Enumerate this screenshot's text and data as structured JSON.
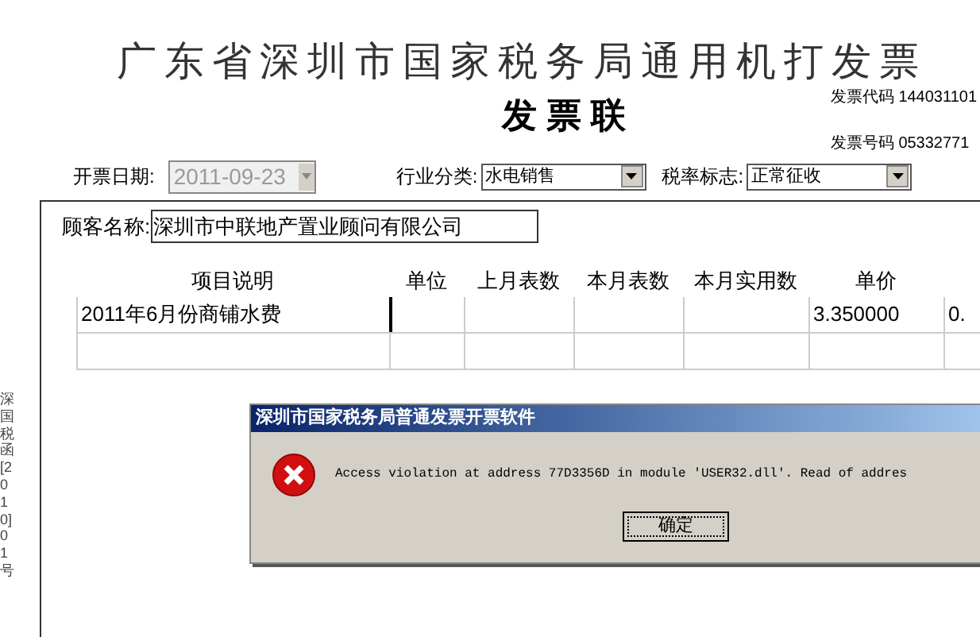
{
  "invoice": {
    "title": "广东省深圳市国家税务局通用机打发票",
    "copy_label": "发 票 联",
    "code_label": "发票代码",
    "code": "144031101",
    "number_label": "发票号码",
    "number": "05332771"
  },
  "fields": {
    "date_label": "开票日期:",
    "date": "2011-09-23",
    "date_disabled": true,
    "industry_label": "行业分类:",
    "industry": "水电销售",
    "tax_label": "税率标志:",
    "tax": "正常征收",
    "customer_label": "顾客名称:",
    "customer": "深圳市中联地产置业顾问有限公司"
  },
  "side_text": "深国税函[2010]01号",
  "table": {
    "columns": [
      "项目说明",
      "单位",
      "上月表数",
      "本月表数",
      "本月实用数",
      "单价"
    ],
    "rows": [
      [
        "2011年6月份商铺水费",
        "",
        "",
        "",
        "",
        "3.350000",
        "0."
      ],
      [
        "",
        "",
        "",
        "",
        "",
        "",
        ""
      ]
    ]
  },
  "dialog": {
    "title": "深圳市国家税务局普通发票开票软件",
    "message": "Access violation at address 77D3356D in module 'USER32.dll'. Read of addres",
    "button": "确定"
  }
}
